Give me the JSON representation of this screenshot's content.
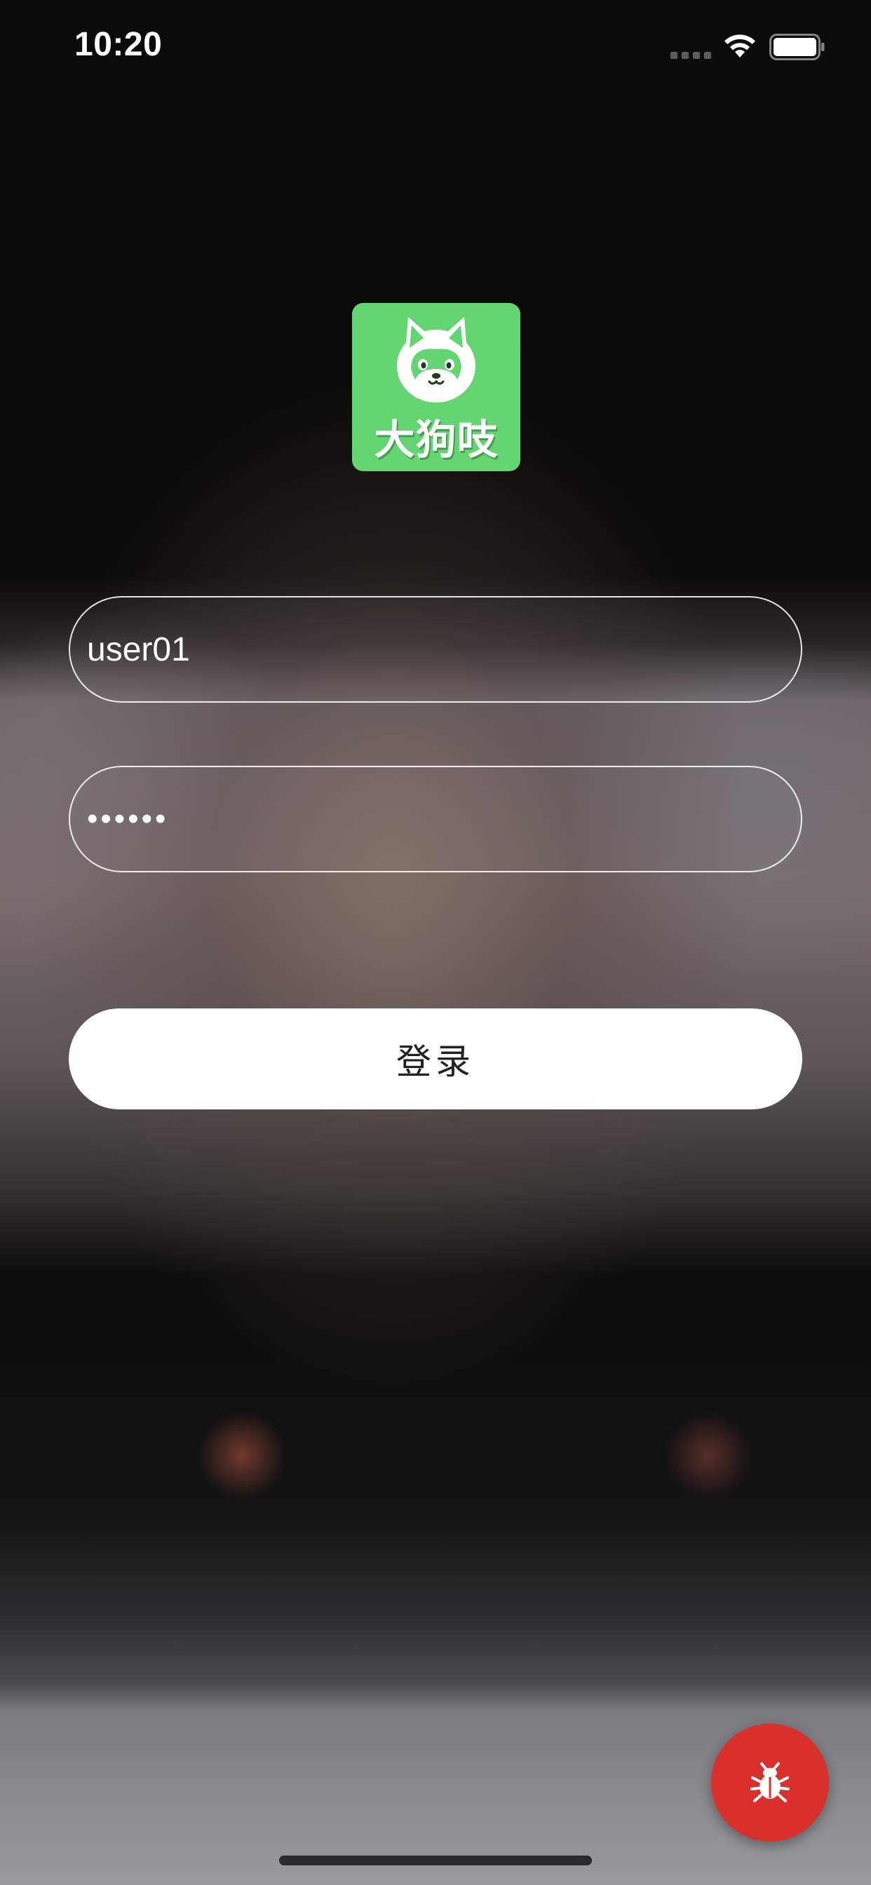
{
  "status_bar": {
    "time": "10:20",
    "icons": [
      "signal-icon",
      "wifi-icon",
      "battery-icon"
    ]
  },
  "logo": {
    "text": "大狗吱",
    "icon": "husky-dog-icon",
    "background_color": "#63d672"
  },
  "form": {
    "username": {
      "value": "user01",
      "placeholder": ""
    },
    "password": {
      "value": "123456",
      "type": "password"
    },
    "login_label": "登录"
  },
  "debug_button": {
    "icon": "bug-icon",
    "color": "#d9302c"
  }
}
